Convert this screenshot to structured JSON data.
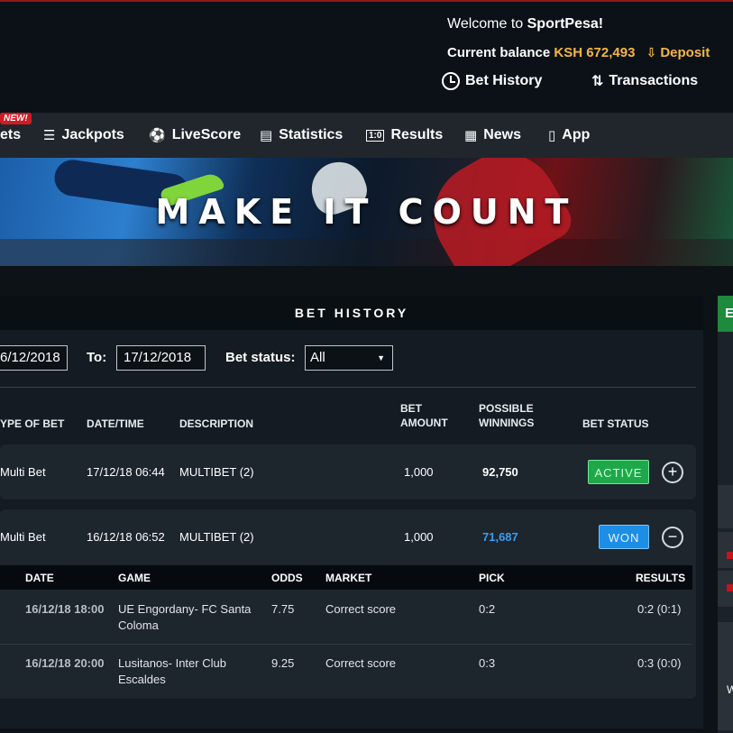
{
  "header": {
    "welcome_prefix": "Welcome to ",
    "brand": "SportPesa!",
    "balance_label": "Current balance ",
    "balance_value": "KSH 672,493",
    "deposit_label": "Deposit",
    "links": [
      {
        "label": "Bet History",
        "icon": "clock-icon"
      },
      {
        "label": "Transactions",
        "icon": "transfer-arrows-icon"
      }
    ]
  },
  "nav": {
    "new_badge": "NEW!",
    "items": [
      {
        "label": "ets",
        "icon": ""
      },
      {
        "label": "Jackpots",
        "icon": "jackpot-stack-icon"
      },
      {
        "label": "LiveScore",
        "icon": "soccer-ball-icon"
      },
      {
        "label": "Statistics",
        "icon": "clipboard-icon"
      },
      {
        "label": "Results",
        "icon": "scoreboard-icon"
      },
      {
        "label": "News",
        "icon": "newspaper-icon"
      },
      {
        "label": "App",
        "icon": "mobile-phone-icon"
      }
    ]
  },
  "banner": {
    "text": "MAKE IT COUNT"
  },
  "bet_history": {
    "title": "BET HISTORY",
    "from_value": "6/12/2018",
    "to_label": "To:",
    "to_value": "17/12/2018",
    "status_label": "Bet status:",
    "status_value": "All",
    "columns": {
      "type": "YPE OF BET",
      "datetime": "DATE/TIME",
      "description": "DESCRIPTION",
      "amount_1": "BET",
      "amount_2": "AMOUNT",
      "winnings_1": "POSSIBLE",
      "winnings_2": "WINNINGS",
      "status": "BET STATUS"
    },
    "bets": [
      {
        "type": "Multi Bet",
        "datetime": "17/12/18 06:44",
        "description": "MULTIBET (2)",
        "amount": "1,000",
        "winnings": "92,750",
        "status": "ACTIVE",
        "toggle": "+"
      },
      {
        "type": "Multi Bet",
        "datetime": "16/12/18 06:52",
        "description": "MULTIBET (2)",
        "amount": "1,000",
        "winnings": "71,687",
        "status": "WON",
        "toggle": "−"
      }
    ],
    "game_columns": {
      "date": "DATE",
      "game": "GAME",
      "odds": "ODDS",
      "market": "MARKET",
      "pick": "PICK",
      "results": "RESULTS"
    },
    "games": [
      {
        "date": "16/12/18 18:00",
        "game_1": "UE Engordany- FC Santa",
        "game_2": "Coloma",
        "odds": "7.75",
        "market": "Correct score",
        "pick": "0:2",
        "result": "0:2 (0:1)"
      },
      {
        "date": "16/12/18 20:00",
        "game_1": "Lusitanos- Inter Club",
        "game_2": "Escaldes",
        "odds": "9.25",
        "market": "Correct score",
        "pick": "0:3",
        "result": "0:3 (0:0)"
      }
    ]
  },
  "side": {
    "green_letter": "E",
    "bottom_letter": "W"
  },
  "colors": {
    "accent": "#f5b642",
    "active": "#1ea84a",
    "won": "#1c8ee6",
    "winnings_blue": "#3a9ef2",
    "brand_red": "#d11b22"
  }
}
